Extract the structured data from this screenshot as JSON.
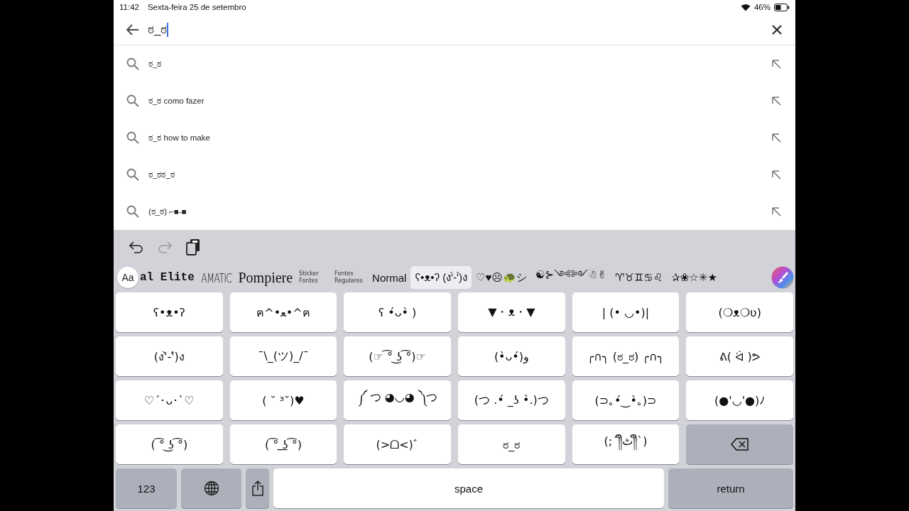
{
  "status_bar": {
    "time": "11:42",
    "date": "Sexta-feira 25 de setembro",
    "battery": "46%"
  },
  "search": {
    "value": "ಠ_ಠ"
  },
  "suggestions": [
    {
      "text": "ಠ_ಠ"
    },
    {
      "text": "ಠ_ಠ como fazer"
    },
    {
      "text": "ಠ_ಠ how to make"
    },
    {
      "text": "ಠ_ಠಠ_ಠ"
    },
    {
      "text": "(ಠ_ಠ) ⌐■-■"
    }
  ],
  "keyboard": {
    "toolbar": [
      {
        "kind": "undo",
        "disabled": false
      },
      {
        "kind": "redo",
        "disabled": true
      },
      {
        "kind": "paste",
        "disabled": false
      }
    ],
    "font_button": "Aa",
    "font_strip": [
      {
        "kind": "elite",
        "label": "al Elite",
        "selected": false
      },
      {
        "kind": "amatic",
        "label": "AMATIC",
        "selected": false
      },
      {
        "kind": "pompiere",
        "label": "Pompiere",
        "selected": false
      },
      {
        "kind": "small",
        "label": "Sticker Fontes",
        "selected": false
      },
      {
        "kind": "small",
        "label": "Fontes Regulares",
        "selected": false
      },
      {
        "kind": "text",
        "label": "Normal",
        "selected": false
      },
      {
        "kind": "text",
        "label": "ʕ•ᴥ•ʔ (ง'̀-'́)ง",
        "selected": true
      },
      {
        "kind": "text",
        "label": "♡♥☹🐢シ",
        "selected": false
      },
      {
        "kind": "text",
        "label": "☯⊱༺༻☃✌",
        "selected": false
      },
      {
        "kind": "text",
        "label": "♈♉♊♋♌",
        "selected": false
      },
      {
        "kind": "text",
        "label": "✰❀☆✳★",
        "selected": false
      }
    ],
    "keys": [
      {
        "kind": "kaomoji",
        "label": "ʕ•ᴥ•ʔ"
      },
      {
        "kind": "kaomoji",
        "label": "ฅ^•ﻌ•^ฅ"
      },
      {
        "kind": "kaomoji",
        "label": "ʕ •́ᴗ•̀ )"
      },
      {
        "kind": "kaomoji",
        "label": "▼・ᴥ・▼"
      },
      {
        "kind": "kaomoji",
        "label": "| (• ◡•)|"
      },
      {
        "kind": "kaomoji",
        "label": "(❍ᴥ❍ʋ)"
      },
      {
        "kind": "kaomoji",
        "label": "(ง'̀-'́)ง"
      },
      {
        "kind": "kaomoji",
        "label": "¯\\_(ツ)_/¯"
      },
      {
        "kind": "kaomoji",
        "label": "(☞ ͡° ͜ʖ ͡°)☞"
      },
      {
        "kind": "kaomoji",
        "label": "(•̀ᴗ•́)و"
      },
      {
        "kind": "kaomoji",
        "label": "╭∩╮ (ಠ_ಠ) ╭∩╮"
      },
      {
        "kind": "kaomoji",
        "label": "ᕕ( ᐛ )ᕗ"
      },
      {
        "kind": "kaomoji",
        "label": "♡´･ᴗ･`♡"
      },
      {
        "kind": "kaomoji",
        "label": "( ˘ ³˘)♥"
      },
      {
        "kind": "kaomoji",
        "label": "༼ つ ◕◡◕ ༽つ"
      },
      {
        "kind": "kaomoji",
        "label": "(つ .•́ _ʖ •̀.)つ"
      },
      {
        "kind": "kaomoji",
        "label": "(⊃｡•́‿•̀｡)⊃"
      },
      {
        "kind": "kaomoji",
        "label": "(●'◡'●)ﾉ"
      },
      {
        "kind": "kaomoji",
        "label": "( ͡° ͜ʖ ͡°)"
      },
      {
        "kind": "kaomoji",
        "label": "( ͡° ͟ʖ ͡°)"
      },
      {
        "kind": "kaomoji",
        "label": "(>ᗝ<)ﾞ"
      },
      {
        "kind": "kaomoji",
        "label": "ಠ_ಠ"
      },
      {
        "kind": "kaomoji",
        "label": "(;´༎ຶٹ༎ຶ`)"
      },
      {
        "kind": "delete"
      }
    ],
    "bottom_row": [
      {
        "kind": "numbers",
        "label": "123"
      },
      {
        "kind": "globe"
      },
      {
        "kind": "share"
      },
      {
        "kind": "space",
        "label": "space"
      },
      {
        "kind": "return",
        "label": "return"
      }
    ]
  }
}
